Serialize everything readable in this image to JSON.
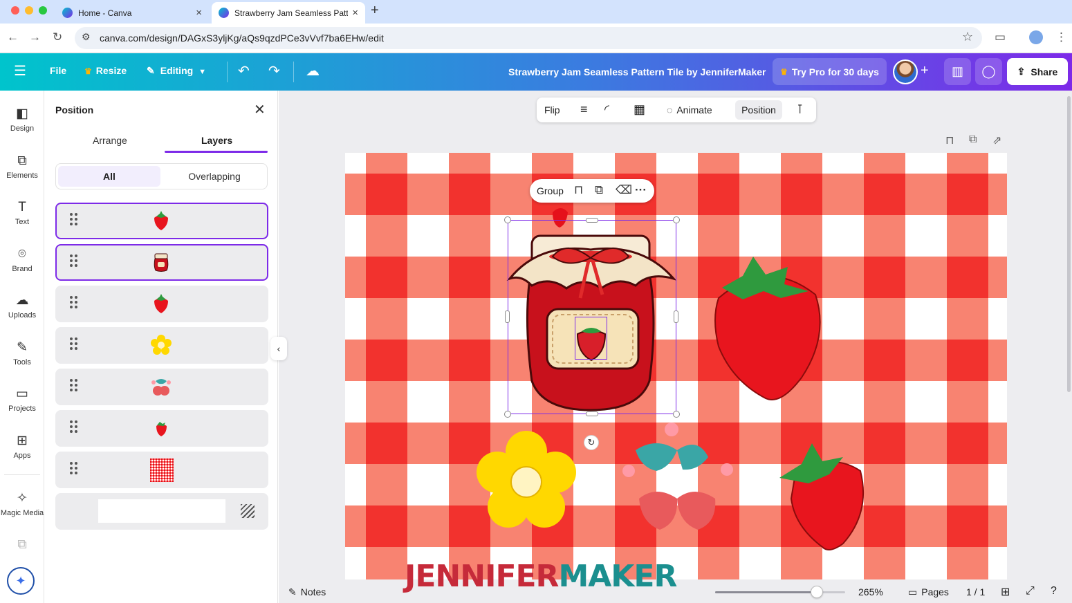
{
  "browser": {
    "tabs": [
      {
        "title": "Home - Canva",
        "active": false
      },
      {
        "title": "Strawberry Jam Seamless Pattern Tile by JenniferMaker",
        "active": true
      }
    ],
    "new_tab": "+",
    "url": "canva.com/design/DAGxS3yljKg/aQs9qzdPCe3vVvf7ba6EHw/edit"
  },
  "toolbar": {
    "file": "File",
    "resize": "Resize",
    "editing": "Editing",
    "design_title": "Strawberry Jam Seamless Pattern Tile by JenniferMaker",
    "try_pro": "Try Pro for 30 days",
    "share": "Share"
  },
  "rail": {
    "items": [
      {
        "label": "Design",
        "icon": "design-icon"
      },
      {
        "label": "Elements",
        "icon": "elements-icon"
      },
      {
        "label": "Text",
        "icon": "text-icon"
      },
      {
        "label": "Brand",
        "icon": "brand-icon"
      },
      {
        "label": "Uploads",
        "icon": "uploads-icon"
      },
      {
        "label": "Tools",
        "icon": "tools-icon"
      },
      {
        "label": "Projects",
        "icon": "projects-icon"
      },
      {
        "label": "Apps",
        "icon": "apps-icon"
      },
      {
        "label": "Magic Media",
        "icon": "magic-media-icon"
      }
    ]
  },
  "panel": {
    "title": "Position",
    "tabs": {
      "arrange": "Arrange",
      "layers": "Layers"
    },
    "filter": {
      "all": "All",
      "overlapping": "Overlapping"
    },
    "layers": [
      {
        "thumb": "strawberry",
        "selected": true
      },
      {
        "thumb": "jam-jar",
        "selected": true
      },
      {
        "thumb": "strawberry",
        "selected": false
      },
      {
        "thumb": "yellow-flower",
        "selected": false
      },
      {
        "thumb": "cherries",
        "selected": false
      },
      {
        "thumb": "small-strawberry",
        "selected": false
      },
      {
        "thumb": "gingham",
        "selected": false
      },
      {
        "thumb": "background",
        "selected": false
      }
    ]
  },
  "context_toolbar": {
    "flip": "Flip",
    "animate": "Animate",
    "position": "Position"
  },
  "floating": {
    "group": "Group"
  },
  "status": {
    "notes": "Notes",
    "zoom": "265%",
    "zoom_fraction": 0.78,
    "pages": "Pages",
    "page_count": "1 / 1"
  },
  "watermark": {
    "part1": "JENNIFER",
    "part2": "MAKER"
  },
  "colors": {
    "accent": "#7d2ae8",
    "canva_teal": "#00c4cc",
    "gingham_red": "#f2322e",
    "gingham_light": "#f88371"
  }
}
